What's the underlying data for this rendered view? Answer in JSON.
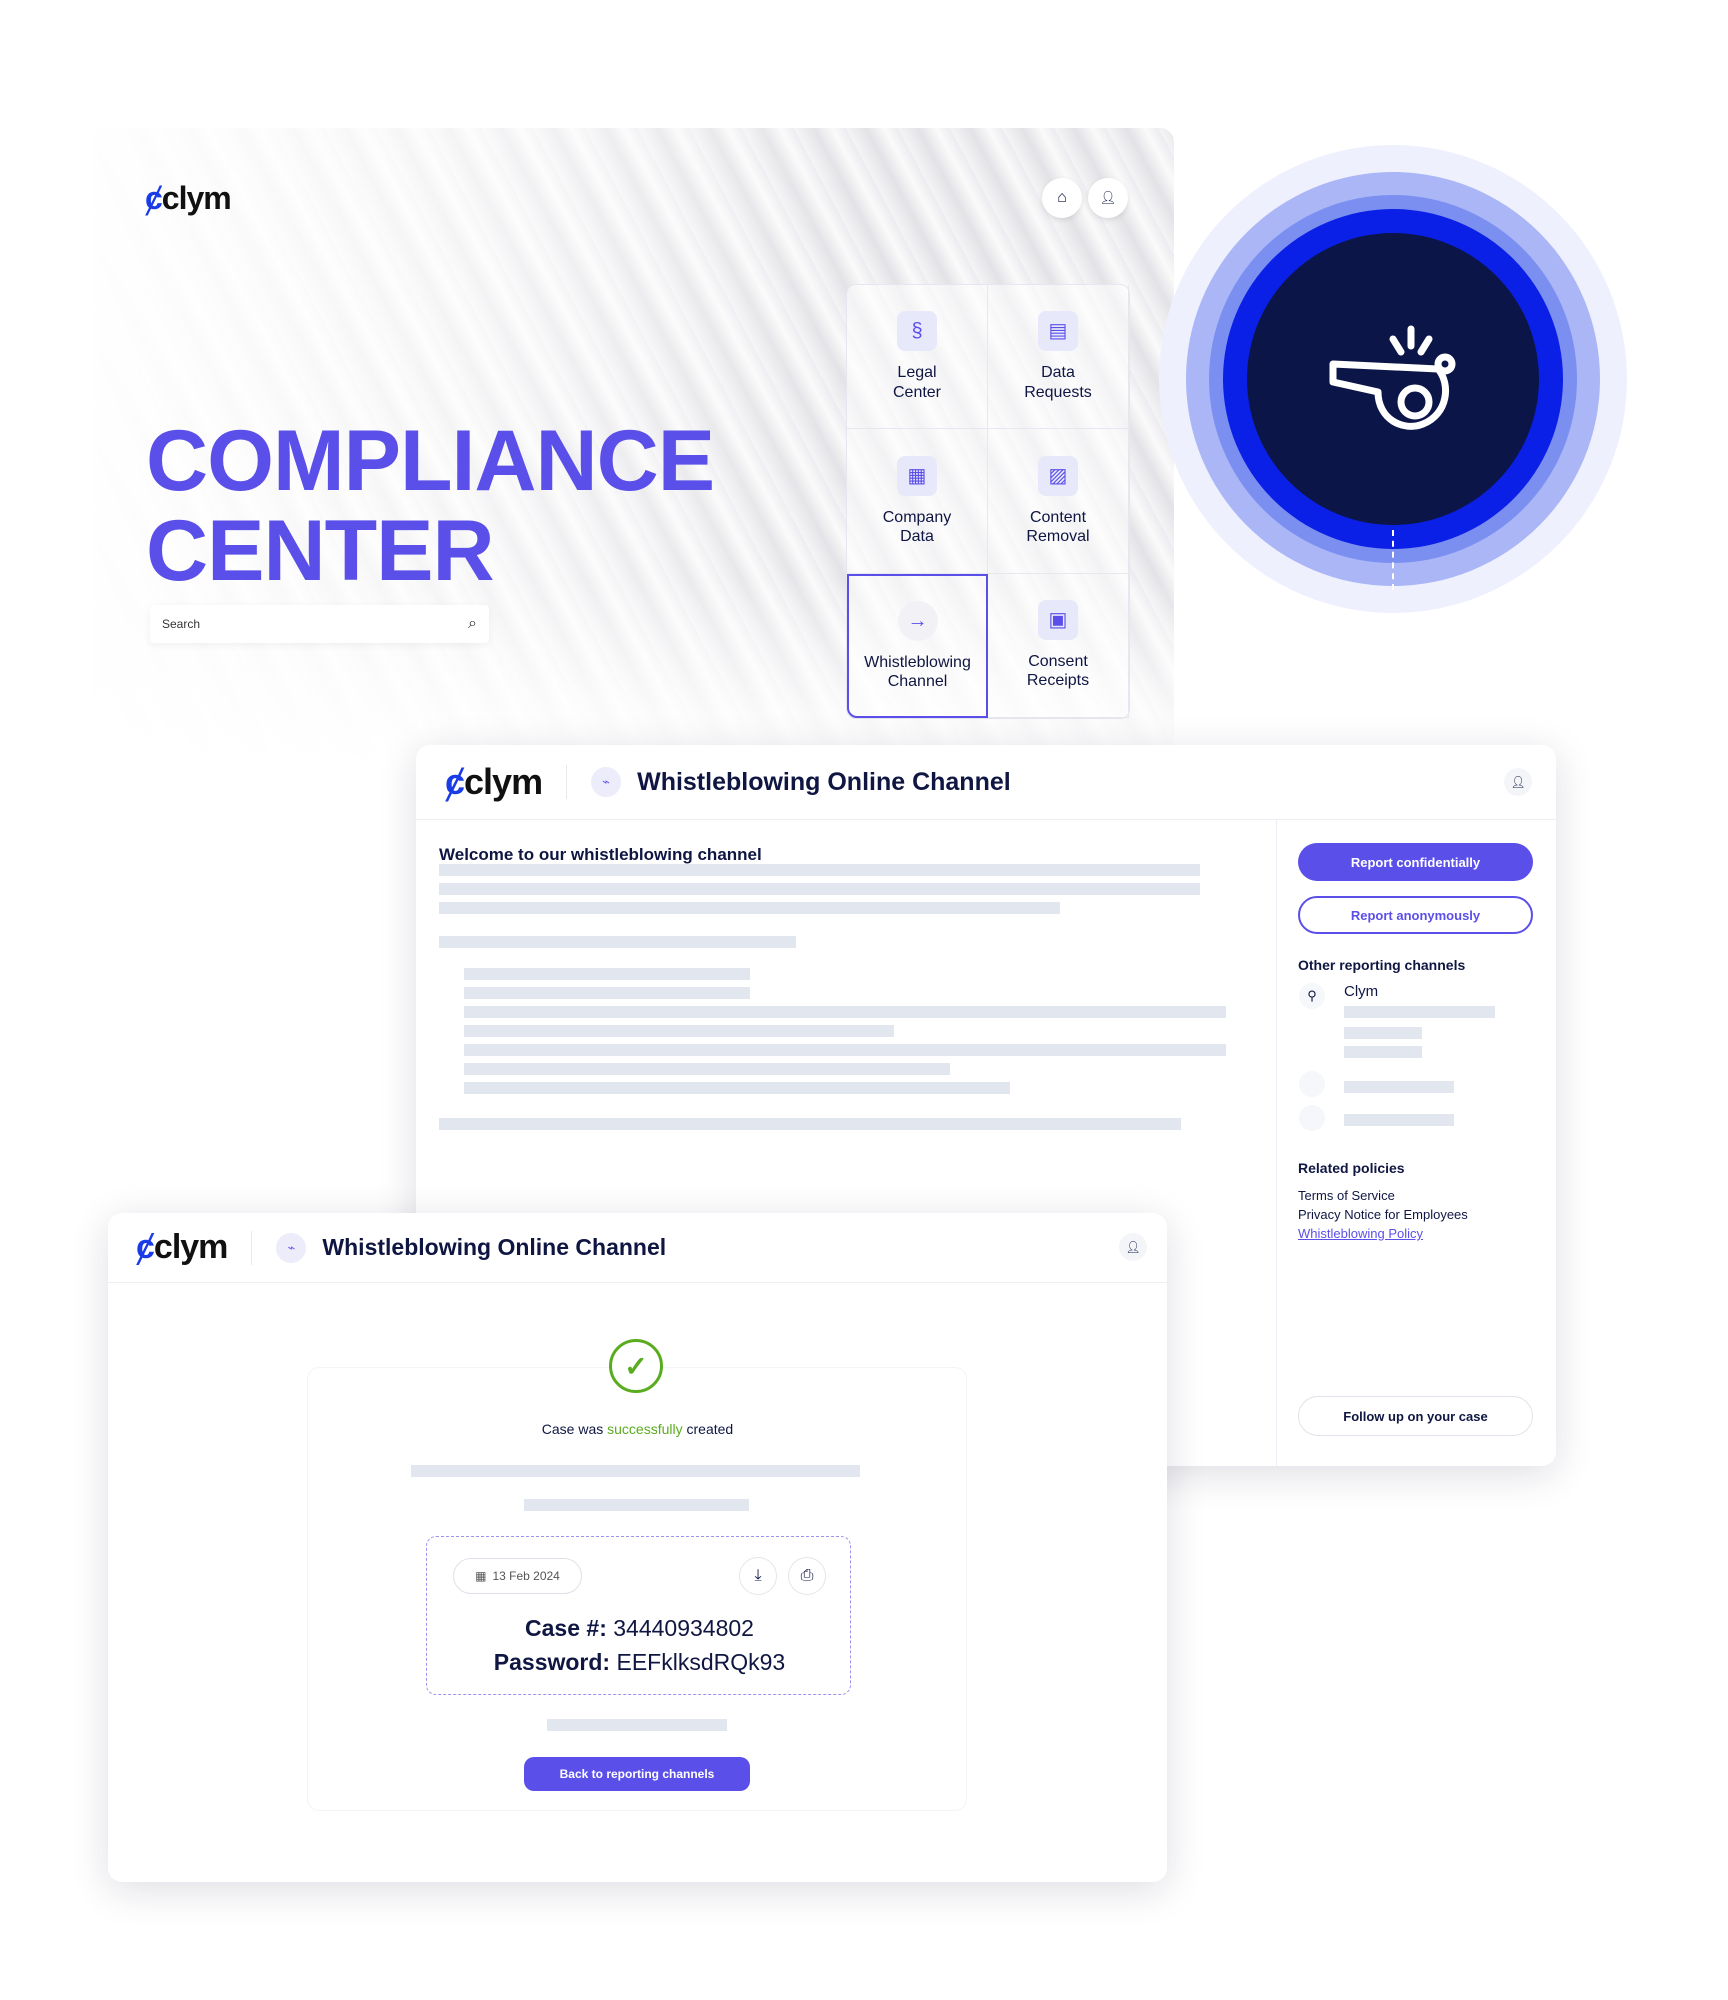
{
  "brand": {
    "logo_text": "clym",
    "accent": "#5b4fe9",
    "navy": "#0f1642",
    "success": "#5aac1f"
  },
  "hero": {
    "title_line1": "COMPLIANCE",
    "title_line2": "CENTER",
    "search": {
      "placeholder": "Search",
      "icon": "search-icon"
    },
    "header_icons": [
      "home-icon",
      "user-icon"
    ],
    "tiles": [
      {
        "label1": "Legal",
        "label2": "Center",
        "icon": "section-sign-icon",
        "glyph": "§"
      },
      {
        "label1": "Data",
        "label2": "Requests",
        "icon": "chat-icon",
        "glyph": "▤"
      },
      {
        "label1": "Company",
        "label2": "Data",
        "icon": "building-icon",
        "glyph": "▦"
      },
      {
        "label1": "Content",
        "label2": "Removal",
        "icon": "image-icon",
        "glyph": "▨"
      },
      {
        "label1": "Whistleblowing",
        "label2": "Channel",
        "icon": "arrow-right-icon",
        "glyph": "→",
        "selected": true
      },
      {
        "label1": "Consent",
        "label2": "Receipts",
        "icon": "document-icon",
        "glyph": "▣"
      }
    ],
    "feature_icon": "whistle-icon"
  },
  "channel": {
    "title": "Whistleblowing Online Channel",
    "welcome": "Welcome to our whistleblowing channel",
    "report_confidentially": "Report confidentially",
    "report_anonymously": "Report anonymously",
    "other_channels_heading": "Other reporting channels",
    "channel_name": "Clym",
    "related_heading": "Related policies",
    "policies": [
      "Terms of Service",
      "Privacy Notice for Employees",
      "Whistleblowing Policy"
    ],
    "follow_up": "Follow up on your case"
  },
  "confirmation": {
    "title": "Whistleblowing Online Channel",
    "msg_prefix": "Case was ",
    "msg_highlight": "successfully",
    "msg_suffix": " created",
    "date": "13 Feb 2024",
    "case_label": "Case #:",
    "case_value": "34440934802",
    "password_label": "Password:",
    "password_value": "EEFklksdRQk93",
    "back_button": "Back to reporting channels"
  }
}
